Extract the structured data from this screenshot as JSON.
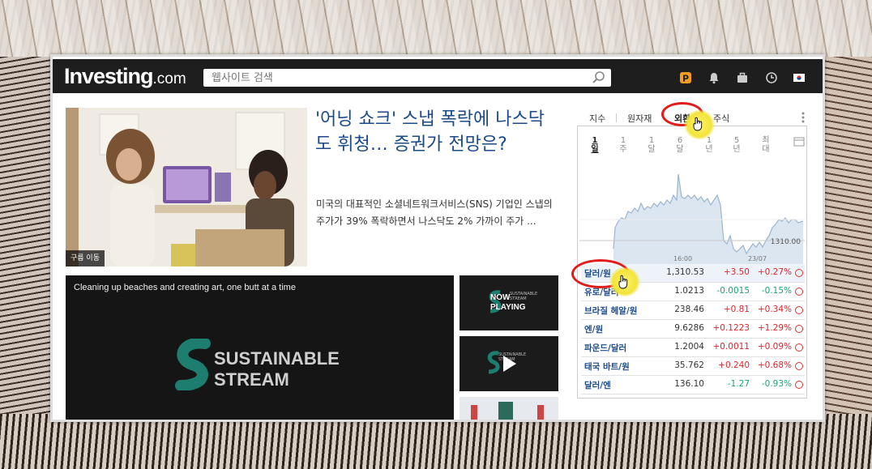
{
  "header": {
    "logo_main": "Investing",
    "logo_suffix": ".com",
    "search_placeholder": "웹사이트 검색"
  },
  "article": {
    "image_caption": "구름 이동",
    "headline": "'어닝 쇼크' 스냅 폭락에 나스닥도 휘청… 증권가 전망은?",
    "summary": "미국의 대표적인 소셜네트워크서비스(SNS) 기업인 스냅의 주가가 39% 폭락하면서 나스닥도 2% 가까이 주가 ..."
  },
  "video": {
    "title": "Cleaning up beaches and creating art, one butt at a time",
    "brand_line1": "SUSTAINABLE",
    "brand_line2": "STREAM",
    "thumb1_line1": "NOW",
    "thumb1_line2": "PLAYING",
    "thumb1_small1": "SUSTAINABLE",
    "thumb1_small2": "STREAM",
    "thumb2_small1": "SUSTAINABLE",
    "thumb2_small2": "STREAM"
  },
  "market": {
    "tabs": [
      "지수",
      "원자재",
      "외환",
      "주식"
    ],
    "active_tab": "외환",
    "periods": [
      {
        "num": "1",
        "unit": "일"
      },
      {
        "num": "1",
        "unit": "주"
      },
      {
        "num": "1",
        "unit": "달"
      },
      {
        "num": "6",
        "unit": "달"
      },
      {
        "num": "1",
        "unit": "년"
      },
      {
        "num": "5",
        "unit": "년"
      },
      {
        "num": "최",
        "unit": "대"
      }
    ],
    "chart": {
      "price_label": "1310.00",
      "x_label_1": "16:00",
      "x_label_2": "23/07",
      "line_color": "#9bb5cf",
      "fill_color": "#dbe6f1"
    },
    "rows": [
      {
        "name": "달러/원",
        "price": "1,310.53",
        "change": "+3.50",
        "pct": "+0.27%",
        "dir": "up"
      },
      {
        "name": "유로/달러",
        "price": "1.0213",
        "change": "-0.0015",
        "pct": "-0.15%",
        "dir": "dn"
      },
      {
        "name": "브라질 헤알/원",
        "price": "238.46",
        "change": "+0.81",
        "pct": "+0.34%",
        "dir": "up"
      },
      {
        "name": "엔/원",
        "price": "9.6286",
        "change": "+0.1223",
        "pct": "+1.29%",
        "dir": "up"
      },
      {
        "name": "파운드/달러",
        "price": "1.2004",
        "change": "+0.0011",
        "pct": "+0.09%",
        "dir": "up"
      },
      {
        "name": "태국 바트/원",
        "price": "35.762",
        "change": "+0.240",
        "pct": "+0.68%",
        "dir": "up"
      },
      {
        "name": "달러/엔",
        "price": "136.10",
        "change": "-1.27",
        "pct": "-0.93%",
        "dir": "dn"
      }
    ]
  },
  "colors": {
    "up": "#d9262c",
    "down": "#1aa37a",
    "link": "#1a4a8a",
    "highlight_ring": "#e21b1b"
  }
}
